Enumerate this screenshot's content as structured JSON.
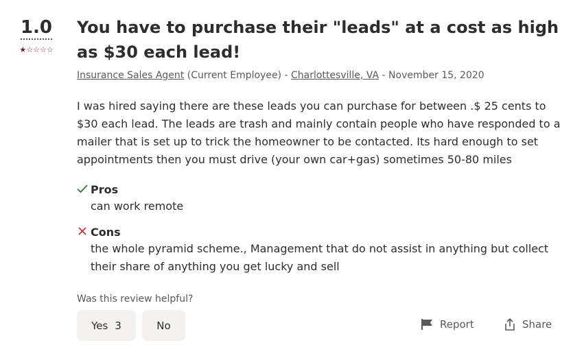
{
  "review": {
    "rating": "1.0",
    "stars": {
      "filled": 1,
      "total": 5
    },
    "title": "You have to purchase their \"leads\" at a cost as high as $30 each lead!",
    "job_title": "Insurance Sales Agent",
    "employment_status": "(Current Employee)",
    "separator1": "-",
    "location": "Charlottesville, VA",
    "separator2": "-",
    "date": "November 15, 2020",
    "body": "I was hired saying there are these leads you can purchase for between .$ 25 cents to $30 each lead. The leads are trash and mainly contain people who have responded to a mailer that is set up to trick the homeowner to be contacted. Its hard enough to set appointments then you must drive (your own car+gas) sometimes 50-80 miles",
    "pros_label": "Pros",
    "pros_text": "can work remote",
    "cons_label": "Cons",
    "cons_text": "the whole pyramid scheme., Management that do not assist in anything but collect their share of anything you get lucky and sell"
  },
  "feedback": {
    "question": "Was this review helpful?",
    "yes_label": "Yes",
    "yes_count": "3",
    "no_label": "No",
    "report_label": "Report",
    "share_label": "Share"
  },
  "colors": {
    "star": "#6f1b3f",
    "check": "#2d7a2d",
    "cross": "#c4243a",
    "button_bg": "#f3f2f1"
  },
  "icons": {
    "pros": "check-icon",
    "cons": "cross-icon",
    "report": "flag-icon",
    "share": "share-icon"
  }
}
